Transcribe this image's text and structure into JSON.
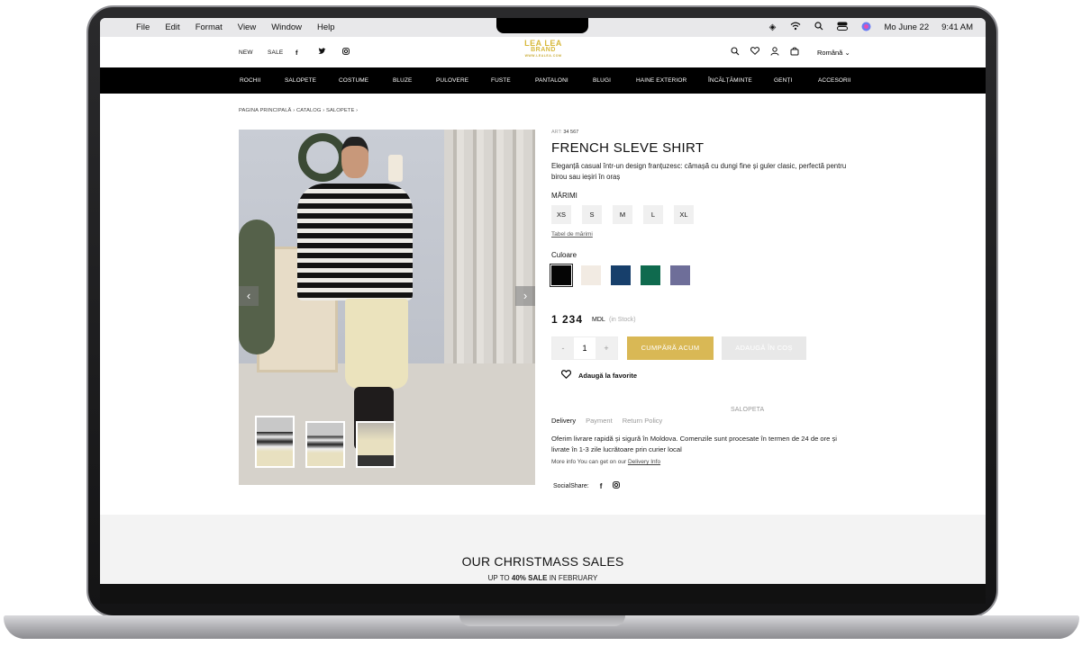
{
  "menubar": {
    "items": [
      "File",
      "Edit",
      "Format",
      "View",
      "Window",
      "Help"
    ],
    "date": "Mo June 22",
    "time": "9:41 AM"
  },
  "header": {
    "links": [
      "NEW",
      "SALE"
    ],
    "logo_line1": "LEA LEA",
    "logo_line2": "BRAND",
    "logo_line3": "WWW.LEALEA.COM",
    "language": "Română"
  },
  "nav": {
    "items": [
      "ROCHII",
      "SALOPETE",
      "COSTUME",
      "BLUZE",
      "PULOVERE",
      "FUSTE",
      "PANTALONI",
      "BLUGI",
      "HAINE EXTERIOR",
      "ÎNCĂLȚĂMINTE",
      "GENȚI",
      "ACCESORII"
    ]
  },
  "breadcrumb": {
    "items": [
      "PAGINA PRINCIPALĂ",
      "CATALOG",
      "SALOPETE"
    ],
    "current": "SALOPETA",
    "separator": "›"
  },
  "product": {
    "art_label": "ART:",
    "art_value": "34 567",
    "title": "FRENCH SLEVE SHIRT",
    "description": "Eleganță casual într-un design franțuzesc: cămașă cu dungi fine și guler clasic, perfectă pentru birou sau ieșiri în oraș",
    "sizes_label": "MĂRIMI",
    "sizes": [
      "XS",
      "S",
      "M",
      "L",
      "XL"
    ],
    "size_table_link": "Tabel de mărimi",
    "color_label": "Culoare",
    "colors": [
      "#050505",
      "#f2ebe3",
      "#173f6b",
      "#0f6a4e",
      "#6e6e99"
    ],
    "price": "1 234",
    "currency": "MDL",
    "stock": "(in Stock)",
    "qty_minus": "-",
    "qty_value": "1",
    "qty_plus": "+",
    "buy_label": "CUMPĂRĂ ACUM",
    "cart_label": "ADAUGĂ ÎN COȘ",
    "favorite_label": "Adaugă la favorite"
  },
  "info_tabs": {
    "tabs": [
      "Delivery",
      "Payment",
      "Return Policy"
    ],
    "delivery_text": "Oferim livrare rapidă și sigură în Moldova. Comenzile sunt procesate în termen de 24 de ore și livrate în 1-3 zile lucrătoare prin curier local",
    "more_prefix": "More info You can get on our",
    "more_link": "Delivery Info"
  },
  "share": {
    "label": "SocialShare:"
  },
  "promo": {
    "title": "OUR CHRISTMASS SALES",
    "sub_prefix": "UP TO",
    "sub_bold": "40% SALE",
    "sub_suffix": "IN FEBRUARY"
  },
  "colors": {
    "accent_gold": "#d9b855",
    "nav_bg": "#000000"
  }
}
